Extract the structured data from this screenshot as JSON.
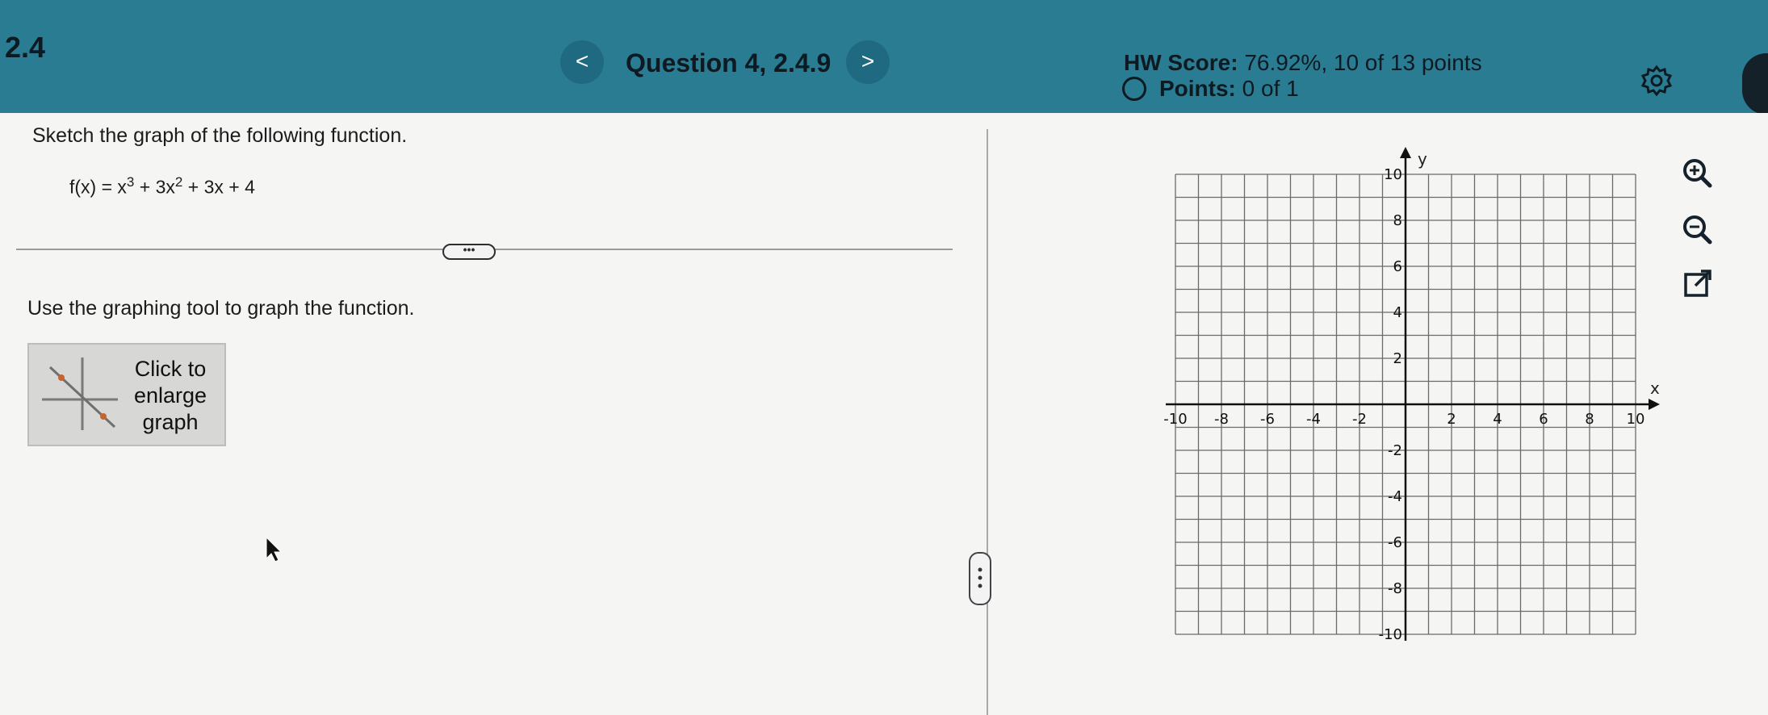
{
  "header": {
    "section": "2.4",
    "prev_icon": "chevron-left-icon",
    "prev_label": "<",
    "question_title": "Question 4, 2.4.9",
    "next_icon": "chevron-right-icon",
    "next_label": ">",
    "hw_score_label": "HW Score:",
    "hw_score_value": "76.92%, 10 of 13 points",
    "points_label": "Points:",
    "points_value": "0 of 1",
    "settings_icon": "gear-icon"
  },
  "question": {
    "prompt": "Sketch the graph of the following function.",
    "function_prefix": "f(x) = x",
    "exp1": "3",
    "mid": " + 3x",
    "exp2": "2",
    "suffix": " + 3x + 4",
    "more_label": "•••",
    "instruction": "Use the graphing tool to graph the function.",
    "enlarge_line1": "Click to",
    "enlarge_line2": "enlarge",
    "enlarge_line3": "graph"
  },
  "graph": {
    "x_label": "x",
    "y_label": "y",
    "x_ticks": [
      "-10",
      "-8",
      "-6",
      "-4",
      "-2",
      "2",
      "4",
      "6",
      "8",
      "10"
    ],
    "y_ticks": [
      "10",
      "8",
      "6",
      "4",
      "2",
      "-2",
      "-4",
      "-6",
      "-8",
      "-10"
    ],
    "xlim": [
      -10,
      10
    ],
    "ylim": [
      -10,
      10
    ],
    "grid": true
  },
  "tools": {
    "zoom_in_icon": "zoom-in-icon",
    "zoom_out_icon": "zoom-out-icon",
    "popout_icon": "external-link-icon"
  },
  "colors": {
    "header": "#2a7c93",
    "accent": "#1f6a80"
  }
}
